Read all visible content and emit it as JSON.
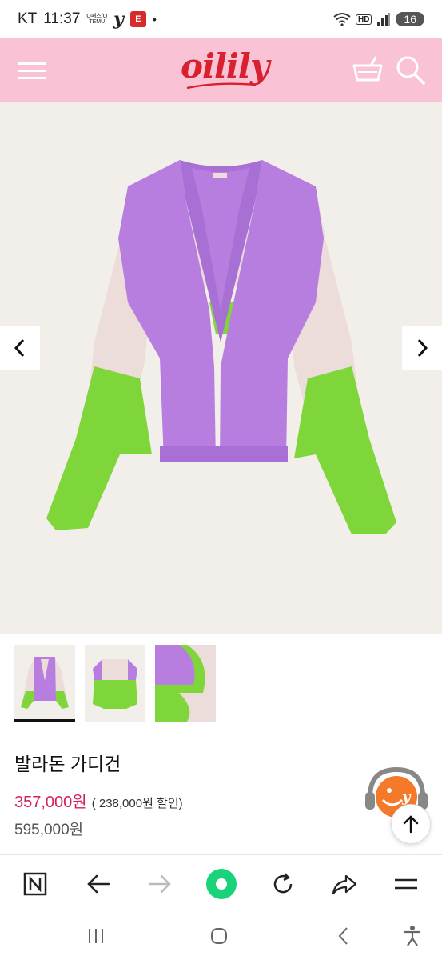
{
  "status": {
    "carrier": "KT",
    "time": "11:37",
    "mini_app_top": "Q패스/Q",
    "mini_app_bottom": "TEMU",
    "e_badge": "E",
    "hd": "HD",
    "battery": "16"
  },
  "header": {
    "logo": "oilily",
    "menu_icon": "hamburger-icon",
    "cart_icon": "basket-icon",
    "search_icon": "search-icon",
    "background": "#f9c2d5",
    "logo_color": "#d9202e"
  },
  "gallery": {
    "prev_icon": "chevron-left-icon",
    "next_icon": "chevron-right-icon",
    "thumbnail_count": 3,
    "active_index": 0
  },
  "product": {
    "name": "발라돈 가디건",
    "price": "357,000원",
    "discount_note": "( 238,000원 할인)",
    "original_price": "595,000원",
    "price_color": "#d4215a"
  },
  "colors": {
    "purple": "#b77ee0",
    "green": "#7fd63a",
    "cream": "#ecdcda"
  },
  "floating": {
    "chat_icon": "chatbot-headset-icon",
    "scroll_top_icon": "arrow-up-icon"
  },
  "browser_toolbar": {
    "items": [
      "n-menu-icon",
      "back-arrow-icon",
      "forward-arrow-icon",
      "home-green-icon",
      "reload-icon",
      "share-icon",
      "more-menu-icon"
    ]
  },
  "system_nav": {
    "items": [
      "recents-icon",
      "home-icon",
      "back-icon",
      "accessibility-icon"
    ]
  }
}
